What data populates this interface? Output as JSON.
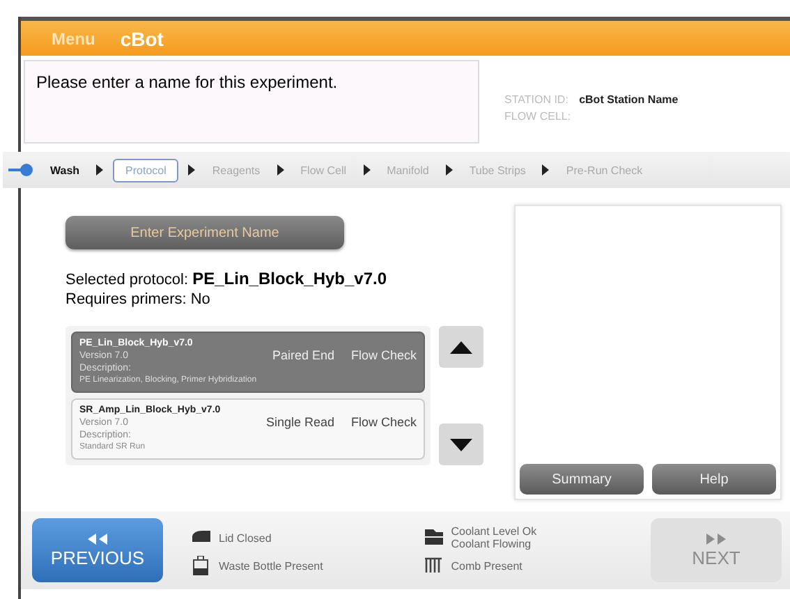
{
  "header": {
    "menu": "Menu",
    "title": "cBot"
  },
  "message": "Please enter a name for this experiment.",
  "station": {
    "id_label": "STATION ID:",
    "id_value": "cBot Station Name",
    "flow_cell_label": "FLOW CELL:"
  },
  "steps": [
    {
      "label": "Wash",
      "selected": false,
      "completed": true
    },
    {
      "label": "Protocol",
      "selected": true,
      "completed": false
    },
    {
      "label": "Reagents",
      "selected": false,
      "completed": false
    },
    {
      "label": "Flow Cell",
      "selected": false,
      "completed": false
    },
    {
      "label": "Manifold",
      "selected": false,
      "completed": false
    },
    {
      "label": "Tube Strips",
      "selected": false,
      "completed": false
    },
    {
      "label": "Pre-Run Check",
      "selected": false,
      "completed": false
    }
  ],
  "enter_button": "Enter Experiment Name",
  "selected_protocol": {
    "label": "Selected protocol:",
    "value": "PE_Lin_Block_Hyb_v7.0"
  },
  "requires_primers": {
    "label": "Requires primers:",
    "value": "No"
  },
  "protocols": [
    {
      "name": "PE_Lin_Block_Hyb_v7.0",
      "version": "Version 7.0",
      "read_type": "Paired End",
      "check": "Flow Check",
      "description_label": "Description:",
      "description": "PE Linearization, Blocking, Primer Hybridization",
      "selected": true
    },
    {
      "name": "SR_Amp_Lin_Block_Hyb_v7.0",
      "version": "Version 7.0",
      "read_type": "Single Read",
      "check": "Flow Check",
      "description_label": "Description:",
      "description": "Standard SR Run",
      "selected": false
    }
  ],
  "side_buttons": [
    "Summary",
    "Help"
  ],
  "status": [
    {
      "kind": "lid",
      "lines": [
        "Lid Closed"
      ]
    },
    {
      "kind": "bottle",
      "lines": [
        "Waste Bottle Present"
      ]
    },
    {
      "kind": "coolant",
      "lines": [
        "Coolant Level Ok",
        "Coolant Flowing"
      ]
    },
    {
      "kind": "comb",
      "lines": [
        "Comb Present"
      ]
    }
  ],
  "previous": {
    "label": "PREVIOUS",
    "disabled": false
  },
  "next": {
    "label": "NEXT",
    "disabled": true
  }
}
